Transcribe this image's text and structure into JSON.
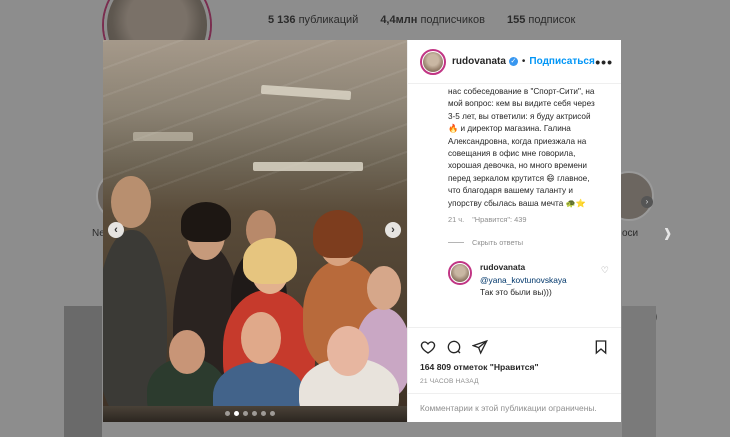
{
  "background": {
    "stats": [
      {
        "num": "5 136",
        "label": "публикаций"
      },
      {
        "num": "4,4млн",
        "label": "подписчиков"
      },
      {
        "num": "155",
        "label": "подписок"
      }
    ],
    "highlights_left_label": "Ne",
    "highlights_right_label": "оси"
  },
  "post": {
    "author": "rudovanata",
    "separator": "•",
    "follow_label": "Подписаться",
    "more_label": "•••",
    "caption": "нас собеседование в \"Спорт-Сити\", на мой вопрос: кем вы видите себя через 3-5 лет, вы ответили: я буду актрисой 🔥 и директор магазина. Галина Александровна, когда приезжала на совещания в офис мне говорила, хорошая девочка, но много времени перед зеркалом крутится 😄 главное, что благодаря вашему таланту и упорству сбылась ваша мечта 🐢⭐",
    "caption_age": "21 ч.",
    "caption_likes": "\"Нравится\": 439",
    "hide_replies": "Скрыть ответы",
    "reply": {
      "author": "rudovanata",
      "mention": "@yana_kovtunovskaya",
      "text": "Так это были вы)))"
    },
    "likes_text": "164 809 отметок \"Нравится\"",
    "time_text": "21 часов назад",
    "comments_closed": "Комментарии к этой публикации ограничены."
  },
  "colors": {
    "accent": "#0095f6",
    "story_ring": "#c13584",
    "verified": "#3897f0"
  }
}
